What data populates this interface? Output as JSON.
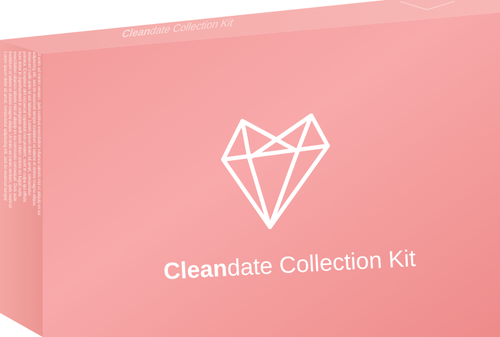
{
  "product": {
    "title_bold": "Clean",
    "title_rest": "date Collection Kit",
    "top_title_bold": "Clean",
    "top_title_rest": "date Collection Kit",
    "side_text_lines": [
      "Lorem ipsum dolor sit amet, consectetur adipiscing elit, sed do eiusmod tempor",
      "incididunt ut labore et dolore magna aliqua. Ut enim ad minim veniam, quis nostrud",
      "exercitation ullamco laboris nisi ut aliquip ex ea commodo consequat. Duis aute",
      "irure dolor in reprehenderit in voluptate velit esse cillum dolore eu fugiat nulla",
      "pariatur. Excepteur sint occaecat cupidatat non proident, sunt in culpa qui officia",
      "deserunt mollit anim id est laborum. Lorem ipsum dolor sit amet, consectetur",
      "adipiscing elit, sed do eiusmod tempor incididunt ut labore et dolore magna aliqua.",
      "Ut enim ad minim veniam, quis nostrud exercitation ullamco laboris nisi ut aliquip ex ea"
    ],
    "logo_icon": "diamond-heart-icon"
  },
  "colors": {
    "front_light": "#f8a9aa",
    "front_mid": "#f59c9c",
    "front_dark": "#ee8a89",
    "side": "#f2a3a0",
    "top": "#f6b0ae",
    "line": "#ffffff"
  }
}
